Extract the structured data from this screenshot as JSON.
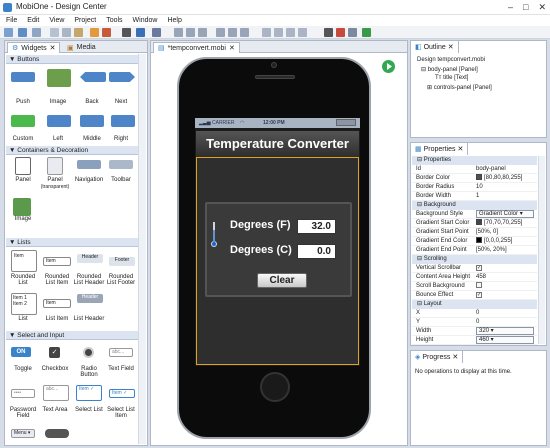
{
  "window": {
    "title": "MobiOne - Design Center"
  },
  "menu": [
    "File",
    "Edit",
    "View",
    "Project",
    "Tools",
    "Window",
    "Help"
  ],
  "left_tabs": [
    "Widgets",
    "Media"
  ],
  "widgets": {
    "sections": [
      "Buttons",
      "Containers & Decoration",
      "Lists",
      "Select and Input"
    ],
    "buttons": [
      "Push",
      "Image",
      "Back",
      "Next",
      "Custom",
      "Left",
      "Middle",
      "Right"
    ],
    "containers": [
      "Panel",
      "Panel",
      "(transparent)",
      "Navigation",
      "Toolbar",
      "Image"
    ],
    "lists": [
      "Rounded List",
      "Rounded List Item",
      "Rounded List Header",
      "Rounded List Footer",
      "List",
      "List Item",
      "List Header"
    ],
    "list_icon_text": {
      "item": "Item",
      "header": "Header",
      "footer": "Footer",
      "item1": "Item 1",
      "item2": "Item 2"
    },
    "inputs": [
      "Toggle",
      "Checkbox",
      "Radio Button",
      "Text Field",
      "Password Field",
      "Text Area",
      "Select List",
      "Select List Item"
    ],
    "input_icon_text": {
      "on": "ON",
      "abc": "abc...",
      "item": "Item",
      "menu": "Menu"
    }
  },
  "editor": {
    "tab": "*tempconvert.mobi"
  },
  "app": {
    "carrier": "CARRIER",
    "time": "12:00 PM",
    "title": "Temperature Converter",
    "fahrenheit_label": "Degrees (F)",
    "fahrenheit_value": "32.0",
    "celsius_label": "Degrees (C)",
    "celsius_value": "0.0",
    "clear_label": "Clear"
  },
  "outline": {
    "tab": "Outline",
    "root": "Design tempconvert.mobi",
    "body": "body-panel [Panel]",
    "title": "title [Text]",
    "controls": "controls-panel [Panel]"
  },
  "properties": {
    "tab": "Properties",
    "groups": [
      "Properties",
      "Background",
      "Scrolling",
      "Layout"
    ],
    "id": {
      "key": "Id",
      "value": "body-panel"
    },
    "border_color": {
      "key": "Border Color",
      "value": "[80,80,80,255]"
    },
    "border_radius": {
      "key": "Border Radius",
      "value": "10"
    },
    "border_width": {
      "key": "Border Width",
      "value": "1"
    },
    "bg_style": {
      "key": "Background Style",
      "value": "Gradient Color"
    },
    "gsc": {
      "key": "Gradient Start Color",
      "value": "[70,70,70,255]"
    },
    "gsp": {
      "key": "Gradient Start Point",
      "value": "[50%, 0]"
    },
    "gec": {
      "key": "Gradient End Color",
      "value": "[0,0,0,255]"
    },
    "gep": {
      "key": "Gradient End Point",
      "value": "[50%, 20%]"
    },
    "vscroll": {
      "key": "Vertical Scrollbar",
      "value": "true"
    },
    "cah": {
      "key": "Content Area Height",
      "value": "458"
    },
    "hscroll": {
      "key": "Scroll Background",
      "value": ""
    },
    "bounce": {
      "key": "Bounce Effect",
      "value": "true"
    },
    "x": {
      "key": "X",
      "value": "0"
    },
    "y": {
      "key": "Y",
      "value": "0"
    },
    "width": {
      "key": "Width",
      "value": "320"
    },
    "height": {
      "key": "Height",
      "value": "460"
    }
  },
  "progress": {
    "tab": "Progress",
    "message": "No operations to display at this time."
  },
  "colors": {
    "accent": "#3b83c9",
    "selection": "#e0a020",
    "run": "#32a852"
  }
}
